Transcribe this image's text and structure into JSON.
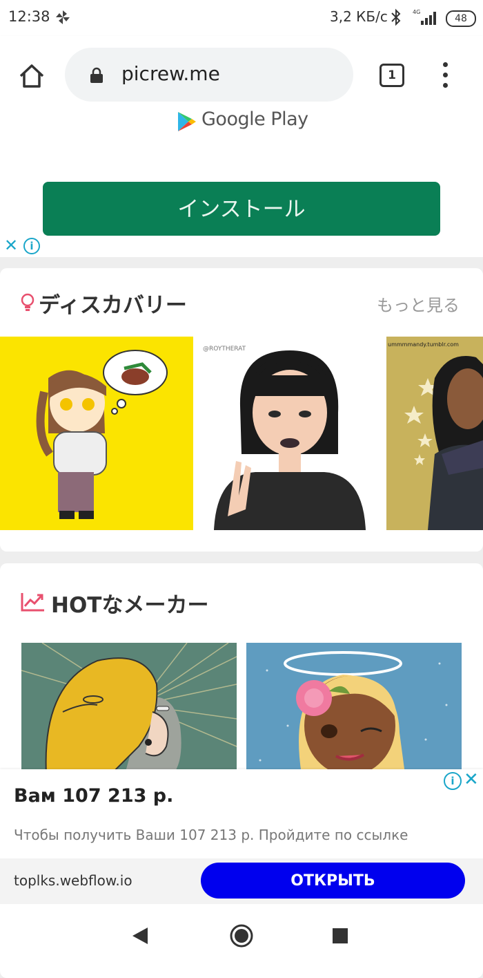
{
  "status_bar": {
    "time": "12:38",
    "network_speed": "3,2 КБ/с",
    "network_type": "4G",
    "battery": "48"
  },
  "browser": {
    "url": "picrew.me",
    "tab_count": "1"
  },
  "top_ad": {
    "store_label": "Google Play",
    "install_label": "インストール",
    "close_symbol": "✕",
    "info_symbol": "i"
  },
  "discovery": {
    "title": "ディスカバリー",
    "more_label": "もっと見る",
    "thumbnails": [
      {
        "watermark": ""
      },
      {
        "watermark": "@ROYTHERAT"
      },
      {
        "watermark": "ummmmandy.tumblr.com"
      }
    ]
  },
  "hot_makers": {
    "title": "HOTなメーカー"
  },
  "bottom_ad": {
    "title": "Вам 107 213 р.",
    "description": "Чтобы получить Ваши 107 213 р. Пройдите по ссылке",
    "domain": "toplks.webflow.io",
    "button_label": "ОТКРЫТЬ",
    "close_symbol": "✕",
    "info_symbol": "i"
  },
  "colors": {
    "install_button": "#0a7f55",
    "open_button": "#0000ee",
    "ad_choices": "#1aa6c9",
    "discovery_icon": "#e8506e",
    "trend_icon": "#e8506e"
  },
  "icons": [
    "home-icon",
    "lock-icon",
    "tabs-icon",
    "more-vert-icon",
    "bulb-icon",
    "trending-icon",
    "back-icon",
    "home-nav-icon",
    "recents-icon"
  ]
}
